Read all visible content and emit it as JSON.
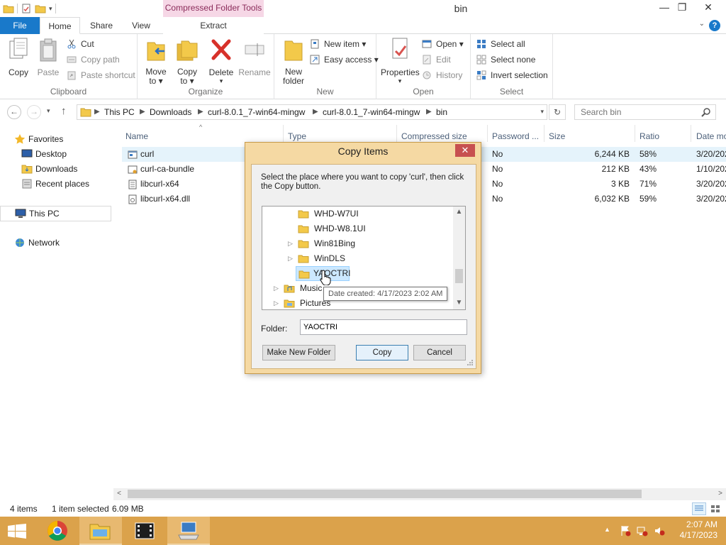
{
  "window": {
    "title": "bin",
    "context_tab_group": "Compressed Folder Tools",
    "minimize": "—",
    "restore": "❐",
    "close": "✕"
  },
  "tabs": {
    "file": "File",
    "home": "Home",
    "share": "Share",
    "view": "View",
    "extract": "Extract",
    "help": "?"
  },
  "ribbon": {
    "clipboard": {
      "label": "Clipboard",
      "copy": "Copy",
      "paste": "Paste",
      "cut": "Cut",
      "copy_path": "Copy path",
      "paste_shortcut": "Paste shortcut"
    },
    "organize": {
      "label": "Organize",
      "move_to": "Move to ▾",
      "copy_to": "Copy to ▾",
      "delete": "Delete",
      "delete_arrow": "▾",
      "rename": "Rename"
    },
    "new": {
      "label": "New",
      "new_folder": "New folder",
      "new_item": "New item ▾",
      "easy_access": "Easy access ▾"
    },
    "open": {
      "label": "Open",
      "properties": "Properties",
      "properties_arrow": "▾",
      "open": "Open ▾",
      "edit": "Edit",
      "history": "History"
    },
    "select": {
      "label": "Select",
      "select_all": "Select all",
      "select_none": "Select none",
      "invert_selection": "Invert selection"
    }
  },
  "address": {
    "back": "←",
    "forward": "→",
    "recent": "▾",
    "up": "↑",
    "crumbs": [
      "This PC",
      "Downloads",
      "curl-8.0.1_7-win64-mingw",
      "curl-8.0.1_7-win64-mingw",
      "bin"
    ],
    "dropdown": "▾",
    "refresh": "↻",
    "search_placeholder": "Search bin"
  },
  "navpane": {
    "favorites": "Favorites",
    "desktop": "Desktop",
    "downloads": "Downloads",
    "recent_places": "Recent places",
    "this_pc": "This PC",
    "network": "Network"
  },
  "filelist": {
    "columns": [
      "Name",
      "Type",
      "Compressed size",
      "Password ...",
      "Size",
      "Ratio",
      "Date mo"
    ],
    "sort_indicator": "^",
    "rows": [
      {
        "name": "curl",
        "password": "No",
        "size": "6,244 KB",
        "ratio": "58%",
        "date": "3/20/202"
      },
      {
        "name": "curl-ca-bundle",
        "password": "No",
        "size": "212 KB",
        "ratio": "43%",
        "date": "1/10/202"
      },
      {
        "name": "libcurl-x64",
        "password": "No",
        "size": "3 KB",
        "ratio": "71%",
        "date": "3/20/202"
      },
      {
        "name": "libcurl-x64.dll",
        "password": "No",
        "size": "6,032 KB",
        "ratio": "59%",
        "date": "3/20/202"
      }
    ],
    "selected_index": 0
  },
  "scroll": {
    "left": "<",
    "right": ">"
  },
  "status": {
    "item_count": "4 items",
    "selection": "1 item selected",
    "selection_size": "6.09 MB"
  },
  "dialog": {
    "title": "Copy Items",
    "close": "✕",
    "instruction": "Select the place where you want to copy 'curl', then click the Copy button.",
    "tree": [
      {
        "label": "WHD-W7UI",
        "indent": 2,
        "expander": ""
      },
      {
        "label": "WHD-W8.1UI",
        "indent": 2,
        "expander": ""
      },
      {
        "label": "Win81Bing",
        "indent": 2,
        "expander": "▷"
      },
      {
        "label": "WinDLS",
        "indent": 2,
        "expander": "▷"
      },
      {
        "label": "YAOCTRI",
        "indent": 2,
        "expander": "",
        "selected": true
      },
      {
        "label": "Music",
        "indent": 1,
        "expander": "▷"
      },
      {
        "label": "Pictures",
        "indent": 1,
        "expander": "▷"
      }
    ],
    "tooltip": "Date created: 4/17/2023 2:02 AM",
    "folder_label": "Folder:",
    "folder_value": "YAOCTRI",
    "make_new_folder": "Make New Folder",
    "copy": "Copy",
    "cancel": "Cancel",
    "scroll_up": "▲",
    "scroll_down": "▼"
  },
  "taskbar": {
    "time": "2:07 AM",
    "date": "4/17/2023",
    "tray_expand": "▲"
  }
}
